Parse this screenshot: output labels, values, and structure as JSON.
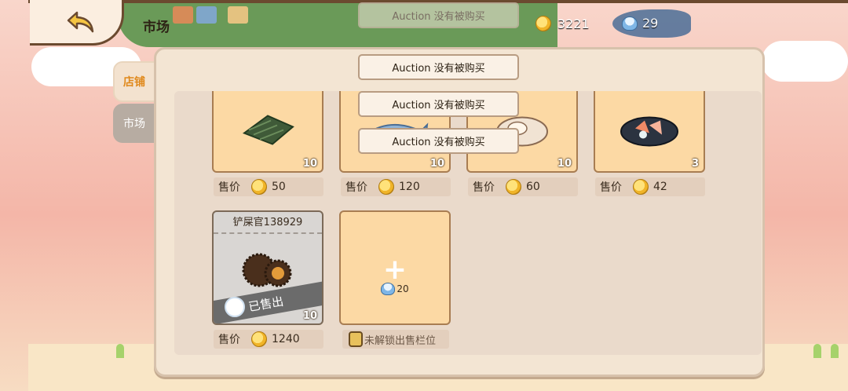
{
  "topbar": {
    "title": "市场",
    "gold": "3221",
    "bells": "29"
  },
  "tabs": [
    {
      "label": "店铺",
      "active": true
    },
    {
      "label": "市场",
      "active": false
    }
  ],
  "slots_row1": [
    {
      "qty": "10",
      "price_label": "售价",
      "price": "50",
      "item": "seaweed-icon"
    },
    {
      "qty": "10",
      "price_label": "售价",
      "price": "120",
      "item": "fish-icon"
    },
    {
      "qty": "10",
      "price_label": "售价",
      "price": "60",
      "item": "shell-icon"
    },
    {
      "qty": "3",
      "price_label": "售价",
      "price": "42",
      "item": "sashimi-icon"
    }
  ],
  "sold_slot": {
    "buyer": "铲屎官138929",
    "status": "已售出",
    "qty": "10",
    "price_label": "售价",
    "price": "1240",
    "item": "sea-urchin-icon"
  },
  "unlock_slot": {
    "plus": "+",
    "cost": "20",
    "label": "未解锁出售栏位"
  },
  "toasts": [
    "Auction 没有被购买",
    "Auction 没有被购买",
    "Auction 没有被购买",
    "Auction 没有被购买"
  ],
  "colors": {
    "slot_bg": "#fcd9a4",
    "panel_bg": "#f3e5d3",
    "active_tab": "#e0891c"
  }
}
